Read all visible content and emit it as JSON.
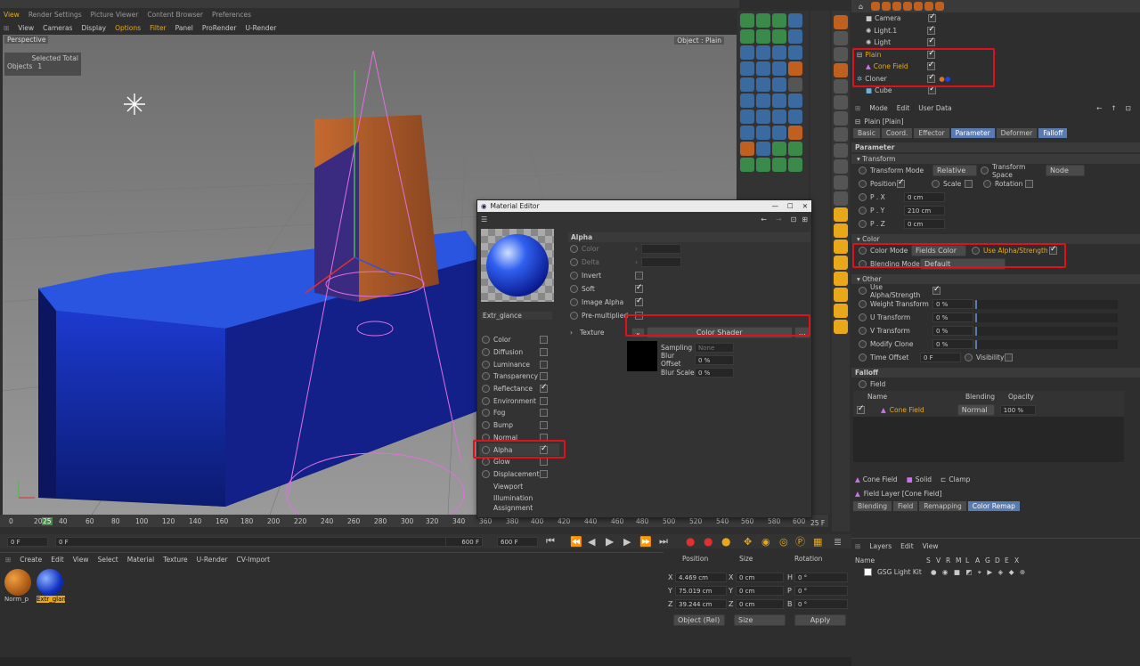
{
  "topbar": {
    "tabs": [
      "View",
      "Render Settings",
      "Picture Viewer",
      "Content Browser",
      "Preferences"
    ]
  },
  "viewport": {
    "menu": [
      "View",
      "Cameras",
      "Display",
      "Options",
      "Filter",
      "Panel",
      "ProRender",
      "U-Render"
    ],
    "label": "Perspective",
    "camera": "Object : Plain",
    "hud_header": "Selected Total",
    "hud_label": "Objects",
    "hud_value": "1"
  },
  "timeline": {
    "ticks": [
      "0",
      "20",
      "25",
      "40",
      "60",
      "80",
      "100",
      "120",
      "140",
      "160",
      "180",
      "200",
      "220",
      "240",
      "260",
      "280",
      "300",
      "320",
      "340",
      "360",
      "380",
      "400",
      "420",
      "440",
      "460",
      "480",
      "500",
      "520",
      "540",
      "560",
      "580",
      "600"
    ],
    "current": "25 F",
    "start": "0 F",
    "start2": "0 F",
    "end": "600 F",
    "end2": "600 F"
  },
  "material_manager": {
    "menu": [
      "Create",
      "Edit",
      "View",
      "Select",
      "Material",
      "Texture",
      "U-Render",
      "CV-Import"
    ],
    "materials": [
      {
        "name": "Norm_p"
      },
      {
        "name": "Extr_glan"
      }
    ]
  },
  "coords": {
    "headers": [
      "Position",
      "Size",
      "Rotation"
    ],
    "rows": [
      {
        "axis": "X",
        "pos": "4.469 cm",
        "size": "0 cm",
        "rot_axis": "H",
        "rot": "0 °"
      },
      {
        "axis": "Y",
        "pos": "75.019 cm",
        "size": "0 cm",
        "rot_axis": "P",
        "rot": "0 °"
      },
      {
        "axis": "Z",
        "pos": "39.244 cm",
        "size": "0 cm",
        "rot_axis": "B",
        "rot": "0 °"
      }
    ],
    "mode": "Object (Rel)",
    "size_mode": "Size",
    "apply": "Apply"
  },
  "material_editor": {
    "title": "Material Editor",
    "material_name": "Extr_glance",
    "channels": [
      {
        "name": "Color",
        "on": false
      },
      {
        "name": "Diffusion",
        "on": false
      },
      {
        "name": "Luminance",
        "on": false
      },
      {
        "name": "Transparency",
        "on": false
      },
      {
        "name": "Reflectance",
        "on": true
      },
      {
        "name": "Environment",
        "on": false
      },
      {
        "name": "Fog",
        "on": false
      },
      {
        "name": "Bump",
        "on": false
      },
      {
        "name": "Normal",
        "on": false
      },
      {
        "name": "Alpha",
        "on": true
      },
      {
        "name": "Glow",
        "on": false
      },
      {
        "name": "Displacement",
        "on": false
      },
      {
        "name": "Viewport",
        "on": false
      },
      {
        "name": "Illumination",
        "on": false
      },
      {
        "name": "Assignment",
        "on": false
      }
    ],
    "section": "Alpha",
    "params": [
      {
        "label": "Color",
        "value": ""
      },
      {
        "label": "Delta",
        "value": ""
      },
      {
        "label": "Invert",
        "checked": false
      },
      {
        "label": "Soft",
        "checked": true
      },
      {
        "label": "Image Alpha",
        "checked": true
      },
      {
        "label": "Pre-multiplied",
        "checked": false
      }
    ],
    "texture_label": "Texture",
    "shader": "Color Shader",
    "sampling_label": "Sampling",
    "sampling_value": "None",
    "blur_offset_label": "Blur Offset",
    "blur_offset_value": "0 %",
    "blur_scale_label": "Blur Scale",
    "blur_scale_value": "0 %"
  },
  "object_manager": {
    "items": [
      {
        "name": "Camera",
        "indent": 1
      },
      {
        "name": "Light.1",
        "indent": 1
      },
      {
        "name": "Light",
        "indent": 1
      },
      {
        "name": "Plain",
        "indent": 0,
        "highlight": true
      },
      {
        "name": "Cone Field",
        "indent": 1,
        "highlight": true
      },
      {
        "name": "Cloner",
        "indent": 0
      },
      {
        "name": "Cube",
        "indent": 1
      }
    ]
  },
  "attributes": {
    "menu": [
      "Mode",
      "Edit",
      "User Data"
    ],
    "object": "Plain [Plain]",
    "tabs": [
      "Basic",
      "Coord.",
      "Effector",
      "Parameter",
      "Deformer",
      "Falloff"
    ],
    "section_param": "Parameter",
    "transform": {
      "title": "Transform",
      "mode_label": "Transform Mode",
      "mode_value": "Relative",
      "space_label": "Transform Space",
      "space_value": "Node",
      "position": "Position",
      "scale": "Scale",
      "rotation": "Rotation",
      "px_label": "P . X",
      "px": "0 cm",
      "py_label": "P . Y",
      "py": "210 cm",
      "pz_label": "P . Z",
      "pz": "0 cm"
    },
    "color": {
      "title": "Color",
      "mode_label": "Color Mode",
      "mode_value": "Fields Color",
      "use_alpha": "Use Alpha/Strength",
      "blend_label": "Blending Mode",
      "blend_value": "Default"
    },
    "other": {
      "title": "Other",
      "use_alpha": "Use Alpha/Strength",
      "weight_label": "Weight Transform",
      "weight": "0 %",
      "u_label": "U Transform",
      "u": "0 %",
      "v_label": "V Transform",
      "v": "0 %",
      "mod_label": "Modify Clone",
      "mod": "0 %",
      "time_label": "Time Offset",
      "time": "0 F",
      "visibility": "Visibility"
    },
    "falloff": {
      "title": "Falloff",
      "field": "Field",
      "cols": [
        "Name",
        "Blending",
        "Opacity"
      ],
      "row_name": "Cone Field",
      "row_blend": "Normal",
      "row_opacity": "100 %"
    },
    "bottom_tabs": [
      "Cone Field",
      "Solid",
      "Clamp"
    ],
    "layer_label": "Field Layer [Cone Field]",
    "layer_tabs": [
      "Blending",
      "Field",
      "Remapping",
      "Color Remap"
    ]
  },
  "layers": {
    "menu": [
      "Layers",
      "Edit",
      "View"
    ],
    "cols": [
      "Name",
      "S",
      "V",
      "R",
      "M",
      "L",
      "A",
      "G",
      "D",
      "E",
      "X"
    ],
    "row": "GSG Light Kit"
  },
  "colors": {
    "accent": "#e8a81a",
    "select": "#5a7bb0",
    "red": "#e0101c"
  }
}
